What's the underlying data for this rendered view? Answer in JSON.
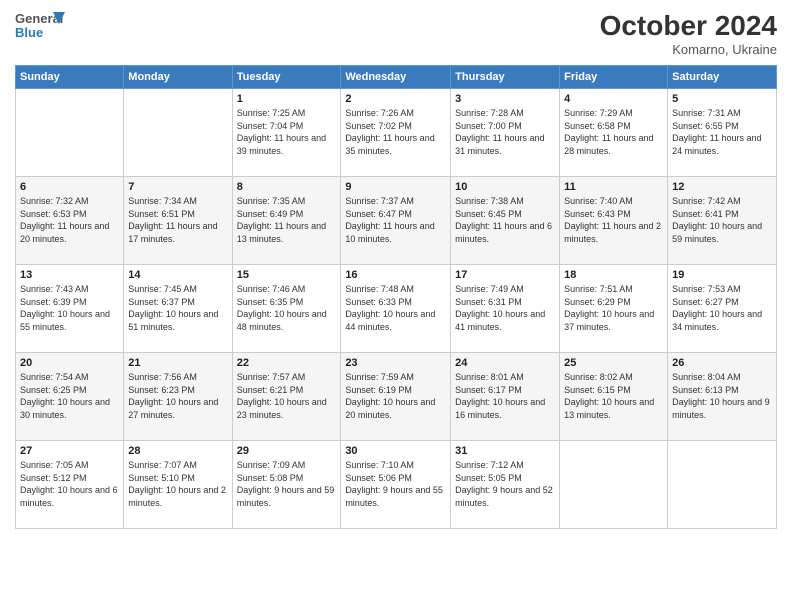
{
  "header": {
    "logo": {
      "line1": "General",
      "line2": "Blue"
    },
    "title": "October 2024",
    "subtitle": "Komarno, Ukraine"
  },
  "weekdays": [
    "Sunday",
    "Monday",
    "Tuesday",
    "Wednesday",
    "Thursday",
    "Friday",
    "Saturday"
  ],
  "weeks": [
    [
      {
        "day": null,
        "info": null
      },
      {
        "day": null,
        "info": null
      },
      {
        "day": "1",
        "info": "Sunrise: 7:25 AM\nSunset: 7:04 PM\nDaylight: 11 hours and 39 minutes."
      },
      {
        "day": "2",
        "info": "Sunrise: 7:26 AM\nSunset: 7:02 PM\nDaylight: 11 hours and 35 minutes."
      },
      {
        "day": "3",
        "info": "Sunrise: 7:28 AM\nSunset: 7:00 PM\nDaylight: 11 hours and 31 minutes."
      },
      {
        "day": "4",
        "info": "Sunrise: 7:29 AM\nSunset: 6:58 PM\nDaylight: 11 hours and 28 minutes."
      },
      {
        "day": "5",
        "info": "Sunrise: 7:31 AM\nSunset: 6:55 PM\nDaylight: 11 hours and 24 minutes."
      }
    ],
    [
      {
        "day": "6",
        "info": "Sunrise: 7:32 AM\nSunset: 6:53 PM\nDaylight: 11 hours and 20 minutes."
      },
      {
        "day": "7",
        "info": "Sunrise: 7:34 AM\nSunset: 6:51 PM\nDaylight: 11 hours and 17 minutes."
      },
      {
        "day": "8",
        "info": "Sunrise: 7:35 AM\nSunset: 6:49 PM\nDaylight: 11 hours and 13 minutes."
      },
      {
        "day": "9",
        "info": "Sunrise: 7:37 AM\nSunset: 6:47 PM\nDaylight: 11 hours and 10 minutes."
      },
      {
        "day": "10",
        "info": "Sunrise: 7:38 AM\nSunset: 6:45 PM\nDaylight: 11 hours and 6 minutes."
      },
      {
        "day": "11",
        "info": "Sunrise: 7:40 AM\nSunset: 6:43 PM\nDaylight: 11 hours and 2 minutes."
      },
      {
        "day": "12",
        "info": "Sunrise: 7:42 AM\nSunset: 6:41 PM\nDaylight: 10 hours and 59 minutes."
      }
    ],
    [
      {
        "day": "13",
        "info": "Sunrise: 7:43 AM\nSunset: 6:39 PM\nDaylight: 10 hours and 55 minutes."
      },
      {
        "day": "14",
        "info": "Sunrise: 7:45 AM\nSunset: 6:37 PM\nDaylight: 10 hours and 51 minutes."
      },
      {
        "day": "15",
        "info": "Sunrise: 7:46 AM\nSunset: 6:35 PM\nDaylight: 10 hours and 48 minutes."
      },
      {
        "day": "16",
        "info": "Sunrise: 7:48 AM\nSunset: 6:33 PM\nDaylight: 10 hours and 44 minutes."
      },
      {
        "day": "17",
        "info": "Sunrise: 7:49 AM\nSunset: 6:31 PM\nDaylight: 10 hours and 41 minutes."
      },
      {
        "day": "18",
        "info": "Sunrise: 7:51 AM\nSunset: 6:29 PM\nDaylight: 10 hours and 37 minutes."
      },
      {
        "day": "19",
        "info": "Sunrise: 7:53 AM\nSunset: 6:27 PM\nDaylight: 10 hours and 34 minutes."
      }
    ],
    [
      {
        "day": "20",
        "info": "Sunrise: 7:54 AM\nSunset: 6:25 PM\nDaylight: 10 hours and 30 minutes."
      },
      {
        "day": "21",
        "info": "Sunrise: 7:56 AM\nSunset: 6:23 PM\nDaylight: 10 hours and 27 minutes."
      },
      {
        "day": "22",
        "info": "Sunrise: 7:57 AM\nSunset: 6:21 PM\nDaylight: 10 hours and 23 minutes."
      },
      {
        "day": "23",
        "info": "Sunrise: 7:59 AM\nSunset: 6:19 PM\nDaylight: 10 hours and 20 minutes."
      },
      {
        "day": "24",
        "info": "Sunrise: 8:01 AM\nSunset: 6:17 PM\nDaylight: 10 hours and 16 minutes."
      },
      {
        "day": "25",
        "info": "Sunrise: 8:02 AM\nSunset: 6:15 PM\nDaylight: 10 hours and 13 minutes."
      },
      {
        "day": "26",
        "info": "Sunrise: 8:04 AM\nSunset: 6:13 PM\nDaylight: 10 hours and 9 minutes."
      }
    ],
    [
      {
        "day": "27",
        "info": "Sunrise: 7:05 AM\nSunset: 5:12 PM\nDaylight: 10 hours and 6 minutes."
      },
      {
        "day": "28",
        "info": "Sunrise: 7:07 AM\nSunset: 5:10 PM\nDaylight: 10 hours and 2 minutes."
      },
      {
        "day": "29",
        "info": "Sunrise: 7:09 AM\nSunset: 5:08 PM\nDaylight: 9 hours and 59 minutes."
      },
      {
        "day": "30",
        "info": "Sunrise: 7:10 AM\nSunset: 5:06 PM\nDaylight: 9 hours and 55 minutes."
      },
      {
        "day": "31",
        "info": "Sunrise: 7:12 AM\nSunset: 5:05 PM\nDaylight: 9 hours and 52 minutes."
      },
      {
        "day": null,
        "info": null
      },
      {
        "day": null,
        "info": null
      }
    ]
  ]
}
